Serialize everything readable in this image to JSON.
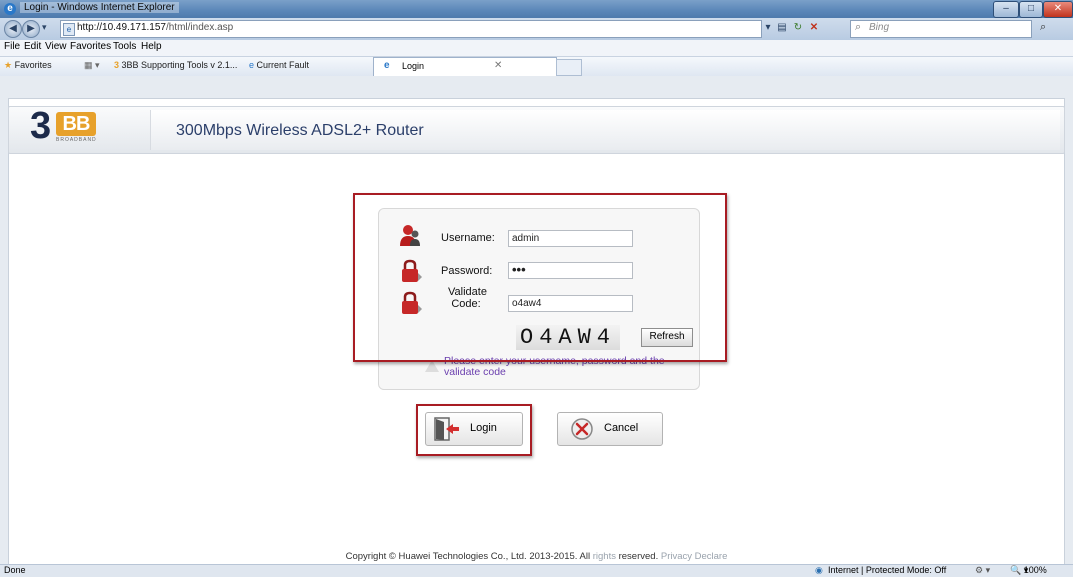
{
  "window": {
    "title": "Login - Windows Internet Explorer",
    "minimize": "–",
    "maximize": "□",
    "close": "✕"
  },
  "address": {
    "url_host": "http://10.49.171.157",
    "url_path": "/html/index.asp",
    "search_placeholder": "Bing"
  },
  "menu": [
    "File",
    "Edit",
    "View",
    "Favorites",
    "Tools",
    "Help"
  ],
  "favorites": {
    "label": "Favorites",
    "items": [
      "3BB Supporting Tools v 2.1...",
      "Current Fault"
    ],
    "active_tab": "Login"
  },
  "router": {
    "logo_text": "BB",
    "logo_digit": "3",
    "logo_sub": "BROADBAND",
    "title": "300Mbps Wireless ADSL2+ Router"
  },
  "form": {
    "username_label": "Username:",
    "username_value": "admin",
    "password_label": "Password:",
    "password_value": "•••",
    "validate_label_1": "Validate",
    "validate_label_2": "Code:",
    "validate_value": "o4aw4",
    "captcha": "O4AW4",
    "refresh_label": "Refresh",
    "message": "Please enter your username, password and the validate code"
  },
  "actions": {
    "login": "Login",
    "cancel": "Cancel"
  },
  "footer": {
    "copyright": "Copyright © Huawei Technologies Co., Ltd. 2013-2015. All ",
    "rights": "rights",
    "reserved": " reserved.",
    "privacy": " Privacy Declare"
  },
  "status": {
    "left": "Done",
    "zone": "Internet | Protected Mode: Off",
    "zoom": "100%"
  },
  "colors": {
    "highlight_red": "#a81c23",
    "message_purple": "#6b3fae",
    "logo_orange": "#e7a12b"
  }
}
